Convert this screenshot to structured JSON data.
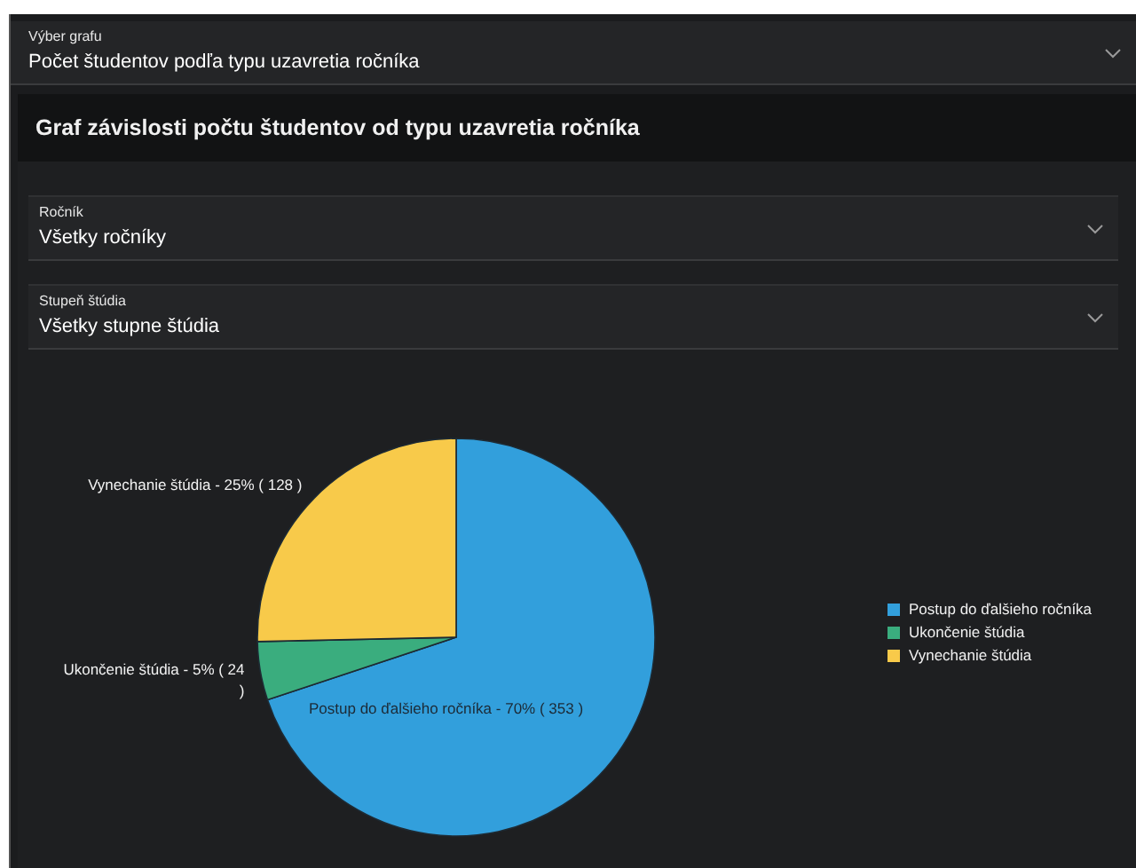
{
  "graph_select": {
    "label": "Výber grafu",
    "value": "Počet študentov podľa typu uzavretia ročníka"
  },
  "card": {
    "title": "Graf závislosti počtu študentov od typu uzavretia ročníka",
    "filters": [
      {
        "label": "Ročník",
        "value": "Všetky ročníky"
      },
      {
        "label": "Stupeň štúdia",
        "value": "Všetky stupne štúdia"
      }
    ],
    "chart_data": {
      "type": "pie",
      "categories": [
        "Postup do ďalšieho ročníka",
        "Ukončenie štúdia",
        "Vynechanie štúdia"
      ],
      "values": [
        353,
        24,
        128
      ],
      "colors": [
        "#329fdc",
        "#3aad7e",
        "#f8ca4a"
      ],
      "legend": true,
      "value_labels": [
        "Postup do ďalšieho ročníka - 70% ( 353 )",
        "Ukončenie štúdia - 5% ( 24 )",
        "Vynechanie štúdia - 25% ( 128 )"
      ]
    }
  }
}
